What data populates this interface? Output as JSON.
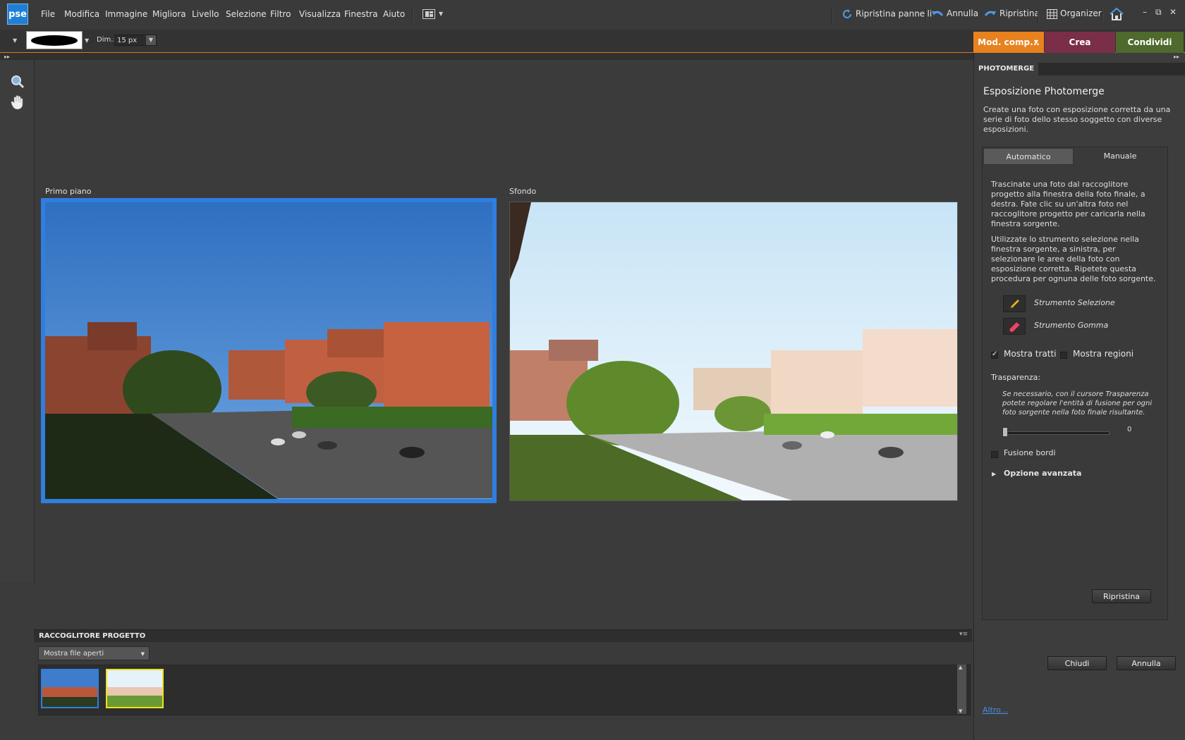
{
  "app": {
    "logo": "pse"
  },
  "menu": [
    "File",
    "Modifica",
    "Immagine",
    "Migliora",
    "Livello",
    "Selezione",
    "Filtro",
    "Visualizza",
    "Finestra",
    "Aiuto"
  ],
  "top_actions": {
    "reset_panels": "Ripristina pannelli",
    "undo": "Annulla",
    "redo": "Ripristina",
    "organizer": "Organizer"
  },
  "window_controls": {
    "minimize": "–",
    "restore": "⧉",
    "close": "✕"
  },
  "options": {
    "dim_label": "Dim.:",
    "dim_value": "15 px"
  },
  "mode_tabs": [
    {
      "label": "Mod. comp...",
      "color": "#e8821e"
    },
    {
      "label": "Crea",
      "color": "#7a2e48"
    },
    {
      "label": "Condividi",
      "color": "#4e6a2c"
    }
  ],
  "canvas": {
    "foreground_label": "Primo piano",
    "background_label": "Sfondo"
  },
  "bin": {
    "title": "RACCOGLITORE PROGETTO",
    "filter": "Mostra file aperti"
  },
  "panel": {
    "tab": "PHOTOMERGE",
    "title": "Esposizione Photomerge",
    "description": "Create una foto con esposizione corretta da una serie di foto dello stesso soggetto con diverse esposizioni.",
    "subtabs": {
      "auto": "Automatico",
      "manual": "Manuale"
    },
    "instructions_1": "Trascinate una foto dal raccoglitore progetto alla finestra della foto finale, a destra. Fate clic su un'altra foto nel raccoglitore progetto per caricarla nella finestra sorgente.",
    "instructions_2": "Utilizzate lo strumento selezione nella finestra sorgente, a sinistra, per selezionare le aree della foto con esposizione corretta. Ripetete questa procedura per ognuna delle foto sorgente.",
    "tool_selection": "Strumento Selezione",
    "tool_eraser": "Strumento Gomma",
    "show_strokes": "Mostra tratti",
    "show_regions": "Mostra regioni",
    "transparency_label": "Trasparenza:",
    "transparency_help": "Se necessario, con il cursore Trasparenza potete regolare l'entità di fusione per ogni foto sorgente nella foto finale risultante.",
    "transparency_value": "0",
    "edge_blend": "Fusione bordi",
    "advanced": "Opzione avanzata",
    "reset": "Ripristina",
    "close": "Chiudi",
    "cancel": "Annulla",
    "more": "Altro..."
  }
}
